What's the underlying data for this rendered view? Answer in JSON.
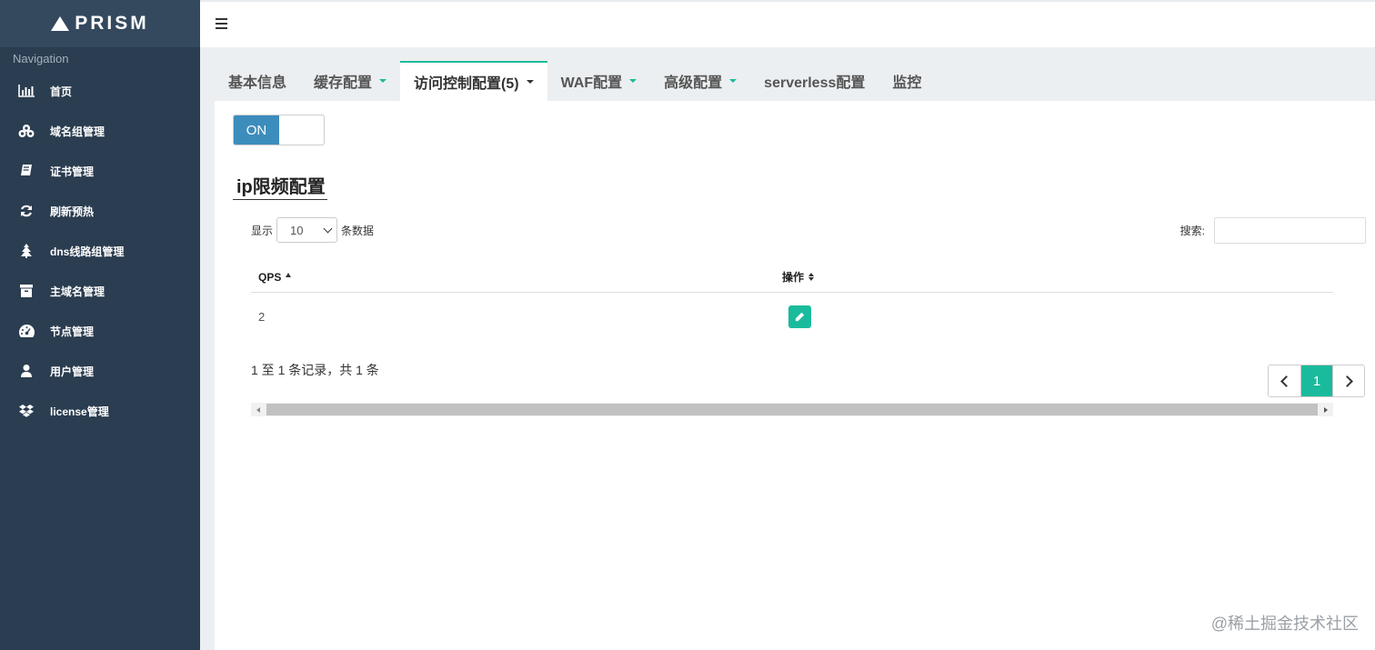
{
  "brand": {
    "name": "PRISM"
  },
  "sidebar": {
    "caption": "Navigation",
    "items": [
      {
        "label": "首页",
        "icon": "bar-chart-icon"
      },
      {
        "label": "域名组管理",
        "icon": "cubes-icon"
      },
      {
        "label": "证书管理",
        "icon": "book-icon"
      },
      {
        "label": "刷新预热",
        "icon": "refresh-icon"
      },
      {
        "label": "dns线路组管理",
        "icon": "tree-icon"
      },
      {
        "label": "主域名管理",
        "icon": "archive-icon"
      },
      {
        "label": "节点管理",
        "icon": "dashboard-icon"
      },
      {
        "label": "用户管理",
        "icon": "user-icon"
      },
      {
        "label": "license管理",
        "icon": "dropbox-icon"
      }
    ]
  },
  "tabs": [
    {
      "label": "基本信息",
      "dropdown": false,
      "active": false
    },
    {
      "label": "缓存配置",
      "dropdown": true,
      "active": false
    },
    {
      "label": "访问控制配置(5)",
      "dropdown": true,
      "active": true
    },
    {
      "label": "WAF配置",
      "dropdown": true,
      "active": false
    },
    {
      "label": "高级配置",
      "dropdown": true,
      "active": false
    },
    {
      "label": "serverless配置",
      "dropdown": false,
      "active": false
    },
    {
      "label": "监控",
      "dropdown": false,
      "active": false
    }
  ],
  "toggle": {
    "on_label": "ON"
  },
  "section": {
    "title": "ip限频配置"
  },
  "table_controls": {
    "show_prefix": "显示",
    "page_length": "10",
    "show_suffix": "条数据",
    "search_label": "搜索:"
  },
  "table": {
    "columns": [
      "QPS",
      "操作"
    ],
    "rows": [
      {
        "qps": "2"
      }
    ],
    "info": "1 至 1 条记录，共 1 条"
  },
  "pagination": {
    "current": "1"
  },
  "colors": {
    "sidebar": "#2b3d50",
    "accent": "#1abb9c",
    "toggle_on": "#3c8dbc"
  },
  "watermark": "@稀土掘金技术社区"
}
